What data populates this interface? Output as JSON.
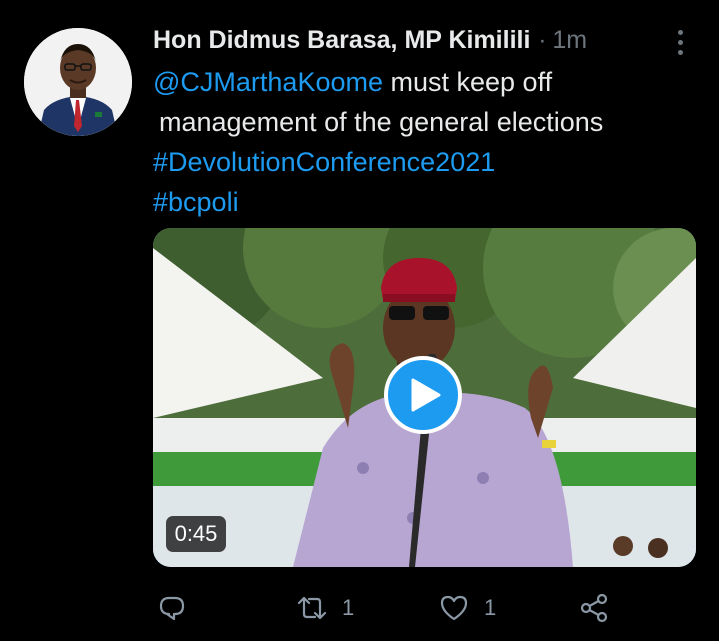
{
  "tweet": {
    "author_name": "Hon Didmus Barasa, MP Kimilili",
    "separator": "·",
    "time": "1m",
    "text_lines": [
      {
        "mention": "@CJMarthaKoome",
        "rest": " must keep off"
      },
      {
        "text": " management of the general elections"
      },
      {
        "hashtag": "#DevolutionConference2021"
      },
      {
        "hashtag": "#bcpoli"
      }
    ]
  },
  "media": {
    "duration": "0:45",
    "type": "video"
  },
  "actions": {
    "reply_count": "",
    "retweet_count": "1",
    "like_count": "1"
  },
  "icons": {
    "reply": "reply-icon",
    "retweet": "retweet-icon",
    "like": "heart-icon",
    "share": "share-icon",
    "more": "more-options-icon",
    "play": "play-icon"
  },
  "colors": {
    "accent": "#1d9bf0",
    "background": "#000000",
    "secondary_text": "#6e767d"
  }
}
